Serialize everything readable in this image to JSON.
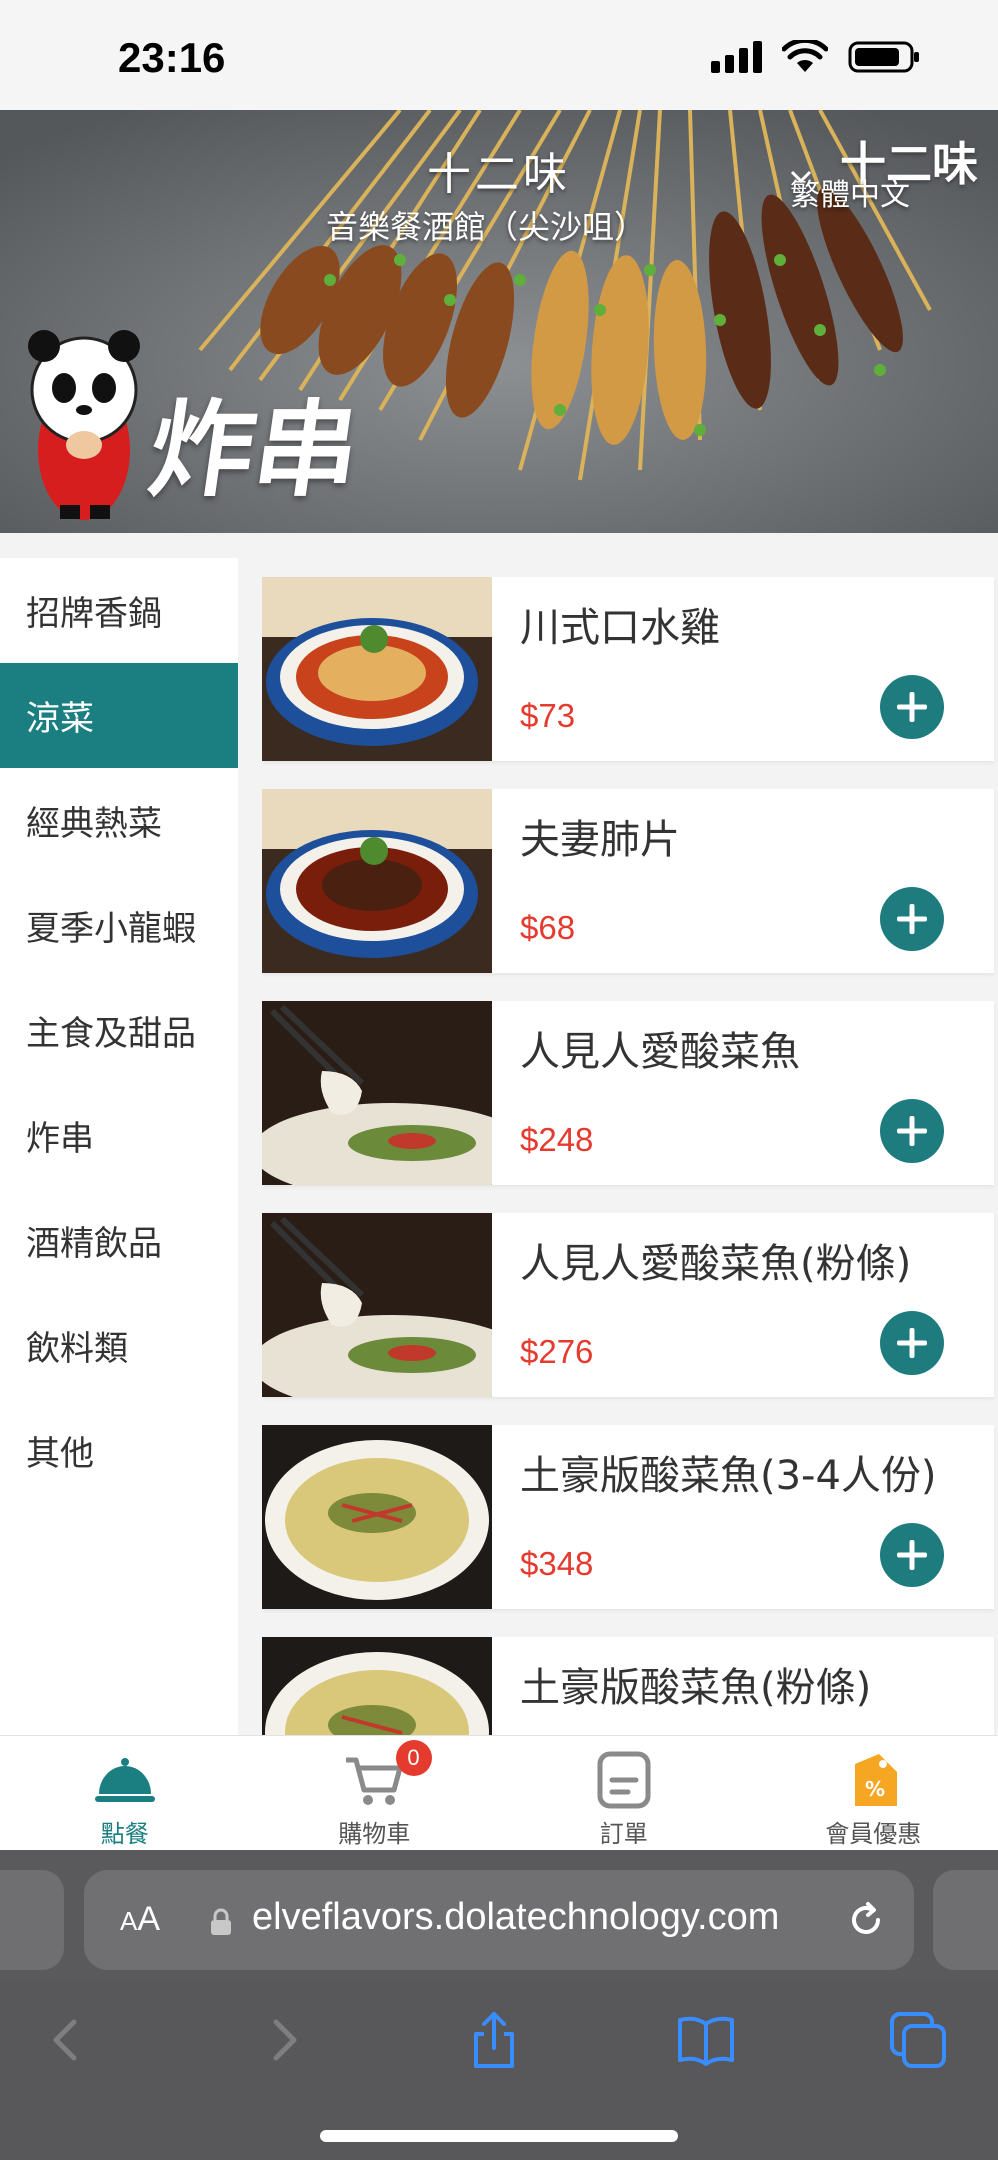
{
  "status_bar": {
    "time": "23:16"
  },
  "banner": {
    "restaurant_name": "十二味",
    "restaurant_subtitle": "音樂餐酒館（尖沙咀）",
    "language": "繁體中文",
    "brand_logo": "十二味",
    "category_image_text": "炸串"
  },
  "sidebar": {
    "active_index": 1,
    "items": [
      "招牌香鍋",
      "涼菜",
      "經典熱菜",
      "夏季小龍蝦",
      "主食及甜品",
      "炸串",
      "酒精飲品",
      "飲料類",
      "其他"
    ]
  },
  "menu": {
    "items": [
      {
        "name": "川式口水雞",
        "price": "$73",
        "image": "chili-chicken-bowl"
      },
      {
        "name": "夫妻肺片",
        "price": "$68",
        "image": "beef-tripe-bowl"
      },
      {
        "name": "人見人愛酸菜魚",
        "price": "$248",
        "image": "pickled-fish-chopsticks"
      },
      {
        "name": "人見人愛酸菜魚(粉條)",
        "price": "$276",
        "image": "pickled-fish-chopsticks"
      },
      {
        "name": "土豪版酸菜魚(3-4人份)",
        "price": "$348",
        "image": "pickled-fish-soup"
      },
      {
        "name": "土豪版酸菜魚(粉條)",
        "price": "",
        "image": "pickled-fish-soup"
      }
    ]
  },
  "bottom_nav": {
    "items": [
      {
        "label": "點餐",
        "icon": "cloche-icon"
      },
      {
        "label": "購物車",
        "icon": "cart-icon"
      },
      {
        "label": "訂單",
        "icon": "order-icon"
      },
      {
        "label": "會員優惠",
        "icon": "discount-tag-icon"
      }
    ],
    "cart_count": "0"
  },
  "browser": {
    "aa_label": "AA",
    "url": "elveflavors.dolatechnology.com"
  },
  "colors": {
    "accent": "#1b7f82",
    "price": "#e53a2e",
    "add_button": "#1e7b7e",
    "discount": "#f5a623"
  }
}
